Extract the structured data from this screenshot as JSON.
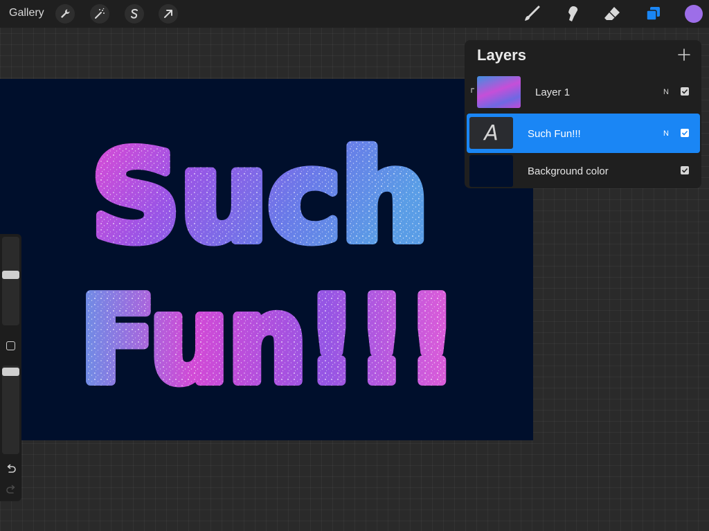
{
  "toolbar": {
    "gallery_label": "Gallery",
    "left_tools": [
      "wrench-icon",
      "magic-wand-icon",
      "selection-icon",
      "transform-arrow-icon"
    ],
    "right_tools": [
      "brush-icon",
      "smudge-icon",
      "eraser-icon",
      "layers-icon"
    ],
    "current_color": "#9d6ee8",
    "layers_active_color": "#1a86f5"
  },
  "canvas": {
    "background": "#000f2c",
    "text_line1": "Such",
    "text_line2": "Fun!!!"
  },
  "layers": {
    "title": "Layers",
    "add_icon": "plus-icon",
    "items": [
      {
        "name": "Layer 1",
        "blend": "N",
        "visible": true,
        "clipped": true,
        "selected": false
      },
      {
        "name": "Such Fun!!!",
        "blend": "N",
        "visible": true,
        "clipped": false,
        "selected": true,
        "thumb_glyph": "A"
      },
      {
        "name": "Background color",
        "blend": "",
        "visible": true,
        "clipped": false,
        "selected": false
      }
    ]
  },
  "sidebar": {
    "controls": [
      "brush-size-slider",
      "modify-button",
      "opacity-slider",
      "undo-icon",
      "redo-icon"
    ]
  }
}
